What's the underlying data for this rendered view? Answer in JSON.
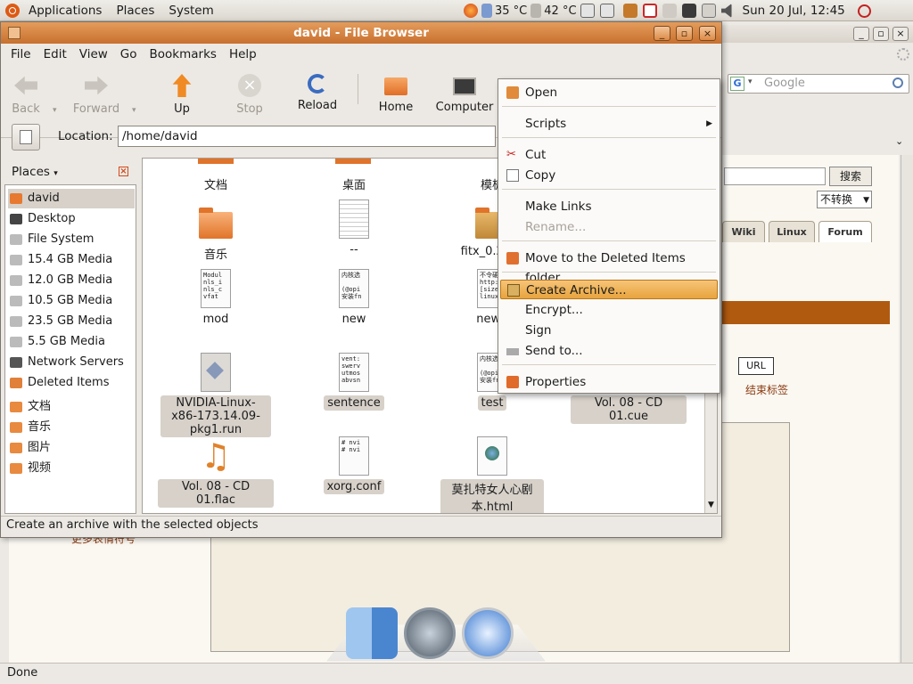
{
  "panel": {
    "menus": [
      "Applications",
      "Places",
      "System"
    ],
    "temp1": "35 °C",
    "temp2": "42 °C",
    "clock": "Sun 20 Jul, 12:45"
  },
  "browser_bg": {
    "search_placeholder": "Google",
    "search_button": "搜索",
    "convert_select": "不转换",
    "tabs": [
      "Wiki",
      "Linux",
      "Forum"
    ],
    "url_button": "URL",
    "end_tag": "结束标签",
    "more_link": "更多表情符号",
    "status": "Done"
  },
  "window": {
    "title": "david - File Browser",
    "menubar": [
      "File",
      "Edit",
      "View",
      "Go",
      "Bookmarks",
      "Help"
    ],
    "toolbar": {
      "back": "Back",
      "forward": "Forward",
      "up": "Up",
      "stop": "Stop",
      "reload": "Reload",
      "home": "Home",
      "computer": "Computer"
    },
    "location_label": "Location:",
    "location_value": "/home/david",
    "places_title": "Places",
    "places": [
      "david",
      "Desktop",
      "File System",
      "15.4 GB Media",
      "12.0 GB Media",
      "10.5 GB Media",
      "23.5 GB Media",
      "5.5 GB Media",
      "Network Servers",
      "Deleted Items",
      "文档",
      "音乐",
      "图片",
      "视频"
    ],
    "files": [
      {
        "name": "文档"
      },
      {
        "name": "桌面"
      },
      {
        "name": "模板"
      },
      {
        "name": "音乐"
      },
      {
        "name": "--"
      },
      {
        "name": "fitx_0.2.0_i"
      },
      {
        "name": "mod",
        "preview": "Modul\nnls_i\nnls_c\nvfat"
      },
      {
        "name": "new",
        "preview": "内核选\n\n(@opi\n安装fn"
      },
      {
        "name": "new f",
        "preview": "不令硬\nhttp:\n[size\nlinux"
      },
      {
        "name": "NVIDIA-Linux-x86-173.14.09-pkg1.run"
      },
      {
        "name": "sentence",
        "preview": "vent:\nswerv\nutmos\nabvsn"
      },
      {
        "name": "test",
        "preview": "内核选\n\n(@opi\n安装fn"
      },
      {
        "name": "Vol. 08 - CD 01.cue"
      },
      {
        "name": "Vol. 08 - CD 01.flac"
      },
      {
        "name": "xorg.conf",
        "preview": "# nvi\n# nvi"
      },
      {
        "name": "莫扎特女人心剧本.html"
      }
    ],
    "status": "Create an archive with the selected objects"
  },
  "context_menu": {
    "items": [
      "Open",
      "Scripts",
      "Cut",
      "Copy",
      "Make Links",
      "Rename...",
      "Move to the Deleted Items folder",
      "Create Archive...",
      "Encrypt...",
      "Sign",
      "Send to...",
      "Properties"
    ]
  }
}
